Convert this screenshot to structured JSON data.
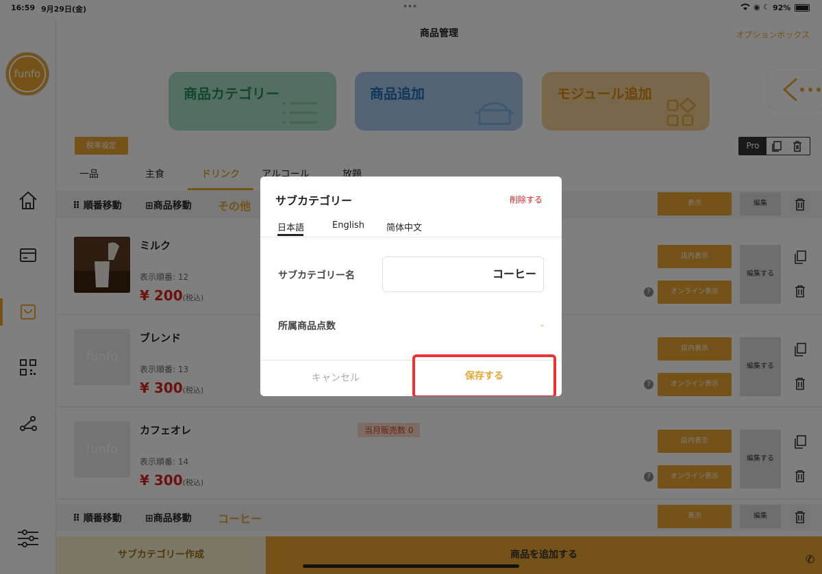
{
  "status": {
    "time": "16:59",
    "date": "9月29日(金)",
    "dots": "•••",
    "battery": "92%"
  },
  "header": {
    "title": "商品管理",
    "option_box": "オプションボックス"
  },
  "logo": {
    "text": "funfo"
  },
  "categories_buttons": [
    {
      "label": "商品カテゴリー",
      "bg": "#a9ddc2",
      "color": "#1f8f55"
    },
    {
      "label": "商品追加",
      "bg": "#a9c8e8",
      "color": "#1e6fb5"
    },
    {
      "label": "モジュール追加",
      "bg": "#f3cf93",
      "color": "#d98a0f"
    }
  ],
  "tax_button": "税率設定",
  "pro_label": "Pro",
  "tabs": [
    "一品",
    "主食",
    "ドリンク",
    "アルコール",
    "放題"
  ],
  "active_tab": "ドリンク",
  "section1": {
    "reorder": "順番移動",
    "move": "商品移動",
    "category": "その他",
    "show": "表示",
    "edit": "編集"
  },
  "products": [
    {
      "name": "ミルク",
      "order": "表示順番: 12",
      "price": "¥ 200",
      "tax": "(税込)",
      "store_show": "店内表示",
      "online_show": "オンライン表示",
      "edit": "編集する",
      "sales": ""
    },
    {
      "name": "ブレンド",
      "order": "表示順番: 13",
      "price": "¥ 300",
      "tax": "(税込)",
      "store_show": "店内表示",
      "online_show": "オンライン表示",
      "edit": "編集する",
      "sales": ""
    },
    {
      "name": "カフェオレ",
      "order": "表示順番: 14",
      "price": "¥ 300",
      "tax": "(税込)",
      "store_show": "店内表示",
      "online_show": "オンライン表示",
      "edit": "編集する",
      "sales": "当月販売数 0"
    }
  ],
  "section2": {
    "reorder": "順番移動",
    "move": "商品移動",
    "category": "コーヒー",
    "show": "表示",
    "edit": "編集"
  },
  "bottom": {
    "create_sub": "サブカテゴリー作成",
    "add_product": "商品を追加する"
  },
  "modal": {
    "title": "サブカテゴリー",
    "delete": "削除する",
    "langs": [
      "日本語",
      "English",
      "简体中文"
    ],
    "name_label": "サブカテゴリー名",
    "name_value": "コーヒー",
    "count_label": "所属商品点数",
    "count_value": "-",
    "cancel": "キャンセル",
    "save": "保存する"
  }
}
